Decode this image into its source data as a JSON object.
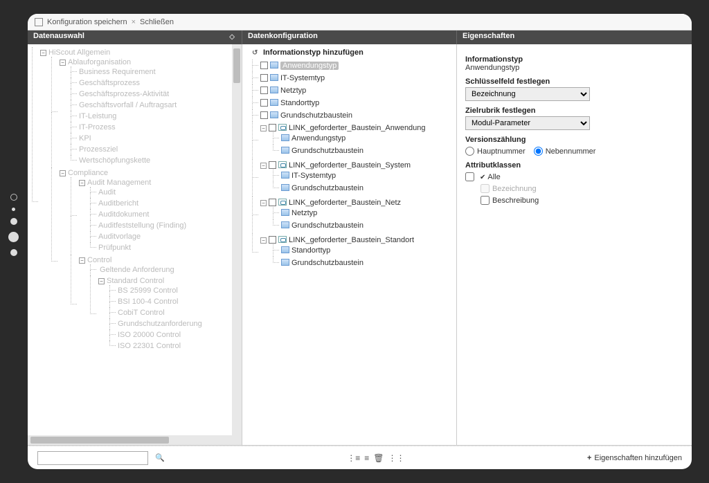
{
  "toolbar": {
    "save": "Konfiguration speichern",
    "close": "Schließen"
  },
  "headers": {
    "left": "Datenauswahl",
    "mid": "Datenkonfiguration",
    "right": "Eigenschaften"
  },
  "left_tree": {
    "cutoff": "HiScout Allgemein",
    "n_ablauf": "Ablauforganisation",
    "ablauf": [
      "Business Requirement",
      "Geschäftsprozess",
      "Geschäftsprozess-Aktivität",
      "Geschäftsvorfall / Auftragsart",
      "IT-Leistung",
      "IT-Prozess",
      "KPI",
      "Prozessziel",
      "Wertschöpfungskette"
    ],
    "n_compliance": "Compliance",
    "n_audit": "Audit Management",
    "audit": [
      "Audit",
      "Auditbericht",
      "Auditdokument",
      "Auditfeststellung (Finding)",
      "Auditvorlage",
      "Prüfpunkt"
    ],
    "n_control": "Control",
    "control_leaf": "Geltende Anforderung",
    "n_std": "Standard Control",
    "std": [
      "BS 25999 Control",
      "BSI 100-4 Control",
      "CobiT Control",
      "Grundschutzanforderung",
      "ISO 20000 Control",
      "ISO 22301 Control"
    ]
  },
  "mid": {
    "title": "Informationstyp hinzufügen",
    "types": [
      "Anwendungstyp",
      "IT-Systemtyp",
      "Netztyp",
      "Standorttyp",
      "Grundschutzbaustein"
    ],
    "links": [
      {
        "name": "LINK_geforderter_Baustein_Anwendung",
        "children": [
          "Anwendungstyp",
          "Grundschutzbaustein"
        ]
      },
      {
        "name": "LINK_geforderter_Baustein_System",
        "children": [
          "IT-Systemtyp",
          "Grundschutzbaustein"
        ]
      },
      {
        "name": "LINK_geforderter_Baustein_Netz",
        "children": [
          "Netztyp",
          "Grundschutzbaustein"
        ]
      },
      {
        "name": "LINK_geforderter_Baustein_Standort",
        "children": [
          "Standorttyp",
          "Grundschutzbaustein"
        ]
      }
    ]
  },
  "props": {
    "h_infotype": "Informationstyp",
    "infotype_val": "Anwendungstyp",
    "h_key": "Schlüsselfeld festlegen",
    "key_val": "Bezeichnung",
    "h_target": "Zielrubrik festlegen",
    "target_val": "Modul-Parameter",
    "h_version": "Versionszählung",
    "r_haupt": "Hauptnummer",
    "r_neben": "Nebennummer",
    "h_attrklassen": "Attributklassen",
    "c_alle": "Alle",
    "c_bez": "Bezeichnung",
    "c_beschr": "Beschreibung"
  },
  "footer": {
    "add_props": "Eigenschaften hinzufügen"
  }
}
